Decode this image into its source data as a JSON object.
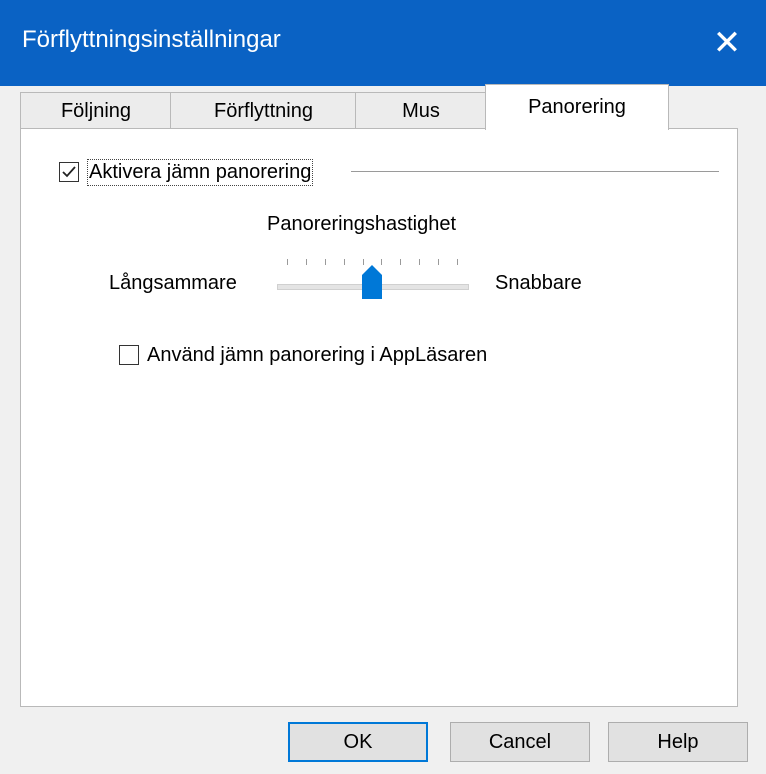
{
  "window": {
    "title": "Förflyttningsinställningar",
    "close_symbol": "✕"
  },
  "tabs": [
    {
      "label": "Följning",
      "active": false
    },
    {
      "label": "Förflyttning",
      "active": false
    },
    {
      "label": "Mus",
      "active": false
    },
    {
      "label": "Panorering",
      "active": true
    }
  ],
  "panorering": {
    "smooth_pan_label": "Aktivera jämn panorering",
    "smooth_pan_checked": true,
    "speed_label": "Panoreringshastighet",
    "slow_label": "Långsammare",
    "fast_label": "Snabbare",
    "speed_ticks": 10,
    "speed_value_fraction": 0.5,
    "applasaren_label": "Använd jämn panorering i AppLäsaren",
    "applasaren_checked": false
  },
  "buttons": {
    "ok": "OK",
    "cancel": "Cancel",
    "help": "Help"
  },
  "colors": {
    "titlebar": "#0a62c4",
    "accent": "#0078d7"
  }
}
